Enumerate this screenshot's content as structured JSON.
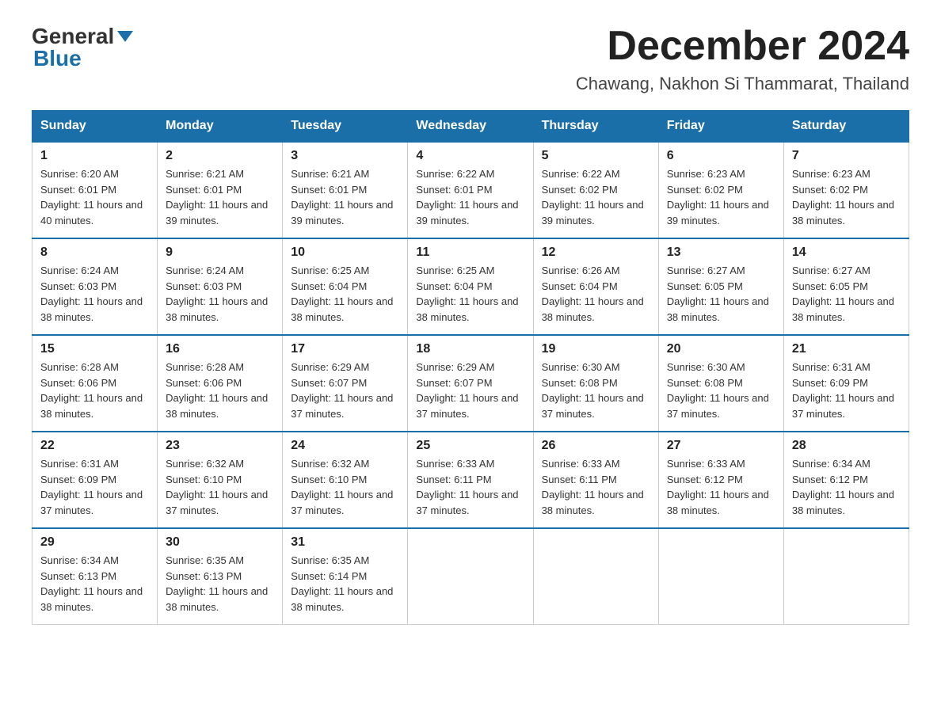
{
  "header": {
    "logo_general": "General",
    "logo_blue": "Blue",
    "month_title": "December 2024",
    "location": "Chawang, Nakhon Si Thammarat, Thailand"
  },
  "weekdays": [
    "Sunday",
    "Monday",
    "Tuesday",
    "Wednesday",
    "Thursday",
    "Friday",
    "Saturday"
  ],
  "weeks": [
    [
      {
        "day": "1",
        "sunrise": "6:20 AM",
        "sunset": "6:01 PM",
        "daylight": "11 hours and 40 minutes."
      },
      {
        "day": "2",
        "sunrise": "6:21 AM",
        "sunset": "6:01 PM",
        "daylight": "11 hours and 39 minutes."
      },
      {
        "day": "3",
        "sunrise": "6:21 AM",
        "sunset": "6:01 PM",
        "daylight": "11 hours and 39 minutes."
      },
      {
        "day": "4",
        "sunrise": "6:22 AM",
        "sunset": "6:01 PM",
        "daylight": "11 hours and 39 minutes."
      },
      {
        "day": "5",
        "sunrise": "6:22 AM",
        "sunset": "6:02 PM",
        "daylight": "11 hours and 39 minutes."
      },
      {
        "day": "6",
        "sunrise": "6:23 AM",
        "sunset": "6:02 PM",
        "daylight": "11 hours and 39 minutes."
      },
      {
        "day": "7",
        "sunrise": "6:23 AM",
        "sunset": "6:02 PM",
        "daylight": "11 hours and 38 minutes."
      }
    ],
    [
      {
        "day": "8",
        "sunrise": "6:24 AM",
        "sunset": "6:03 PM",
        "daylight": "11 hours and 38 minutes."
      },
      {
        "day": "9",
        "sunrise": "6:24 AM",
        "sunset": "6:03 PM",
        "daylight": "11 hours and 38 minutes."
      },
      {
        "day": "10",
        "sunrise": "6:25 AM",
        "sunset": "6:04 PM",
        "daylight": "11 hours and 38 minutes."
      },
      {
        "day": "11",
        "sunrise": "6:25 AM",
        "sunset": "6:04 PM",
        "daylight": "11 hours and 38 minutes."
      },
      {
        "day": "12",
        "sunrise": "6:26 AM",
        "sunset": "6:04 PM",
        "daylight": "11 hours and 38 minutes."
      },
      {
        "day": "13",
        "sunrise": "6:27 AM",
        "sunset": "6:05 PM",
        "daylight": "11 hours and 38 minutes."
      },
      {
        "day": "14",
        "sunrise": "6:27 AM",
        "sunset": "6:05 PM",
        "daylight": "11 hours and 38 minutes."
      }
    ],
    [
      {
        "day": "15",
        "sunrise": "6:28 AM",
        "sunset": "6:06 PM",
        "daylight": "11 hours and 38 minutes."
      },
      {
        "day": "16",
        "sunrise": "6:28 AM",
        "sunset": "6:06 PM",
        "daylight": "11 hours and 38 minutes."
      },
      {
        "day": "17",
        "sunrise": "6:29 AM",
        "sunset": "6:07 PM",
        "daylight": "11 hours and 37 minutes."
      },
      {
        "day": "18",
        "sunrise": "6:29 AM",
        "sunset": "6:07 PM",
        "daylight": "11 hours and 37 minutes."
      },
      {
        "day": "19",
        "sunrise": "6:30 AM",
        "sunset": "6:08 PM",
        "daylight": "11 hours and 37 minutes."
      },
      {
        "day": "20",
        "sunrise": "6:30 AM",
        "sunset": "6:08 PM",
        "daylight": "11 hours and 37 minutes."
      },
      {
        "day": "21",
        "sunrise": "6:31 AM",
        "sunset": "6:09 PM",
        "daylight": "11 hours and 37 minutes."
      }
    ],
    [
      {
        "day": "22",
        "sunrise": "6:31 AM",
        "sunset": "6:09 PM",
        "daylight": "11 hours and 37 minutes."
      },
      {
        "day": "23",
        "sunrise": "6:32 AM",
        "sunset": "6:10 PM",
        "daylight": "11 hours and 37 minutes."
      },
      {
        "day": "24",
        "sunrise": "6:32 AM",
        "sunset": "6:10 PM",
        "daylight": "11 hours and 37 minutes."
      },
      {
        "day": "25",
        "sunrise": "6:33 AM",
        "sunset": "6:11 PM",
        "daylight": "11 hours and 37 minutes."
      },
      {
        "day": "26",
        "sunrise": "6:33 AM",
        "sunset": "6:11 PM",
        "daylight": "11 hours and 38 minutes."
      },
      {
        "day": "27",
        "sunrise": "6:33 AM",
        "sunset": "6:12 PM",
        "daylight": "11 hours and 38 minutes."
      },
      {
        "day": "28",
        "sunrise": "6:34 AM",
        "sunset": "6:12 PM",
        "daylight": "11 hours and 38 minutes."
      }
    ],
    [
      {
        "day": "29",
        "sunrise": "6:34 AM",
        "sunset": "6:13 PM",
        "daylight": "11 hours and 38 minutes."
      },
      {
        "day": "30",
        "sunrise": "6:35 AM",
        "sunset": "6:13 PM",
        "daylight": "11 hours and 38 minutes."
      },
      {
        "day": "31",
        "sunrise": "6:35 AM",
        "sunset": "6:14 PM",
        "daylight": "11 hours and 38 minutes."
      },
      null,
      null,
      null,
      null
    ]
  ]
}
